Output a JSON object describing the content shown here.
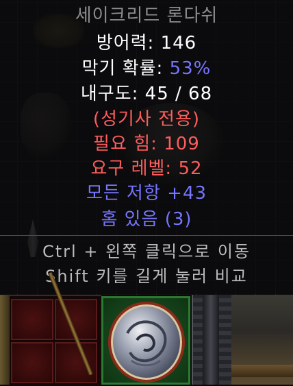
{
  "tooltip": {
    "item_name": "세이크리드 론다쉬",
    "defense": "방어력: 146",
    "block_label": "막기 확률: ",
    "block_value": "53%",
    "durability": "내구도: 45 / 68",
    "class_only": "(성기사 전용)",
    "req_str": "필요 힘: 109",
    "req_level": "요구 레벨: 52",
    "all_resist": "모든 저항 +43",
    "sockets": "홈 있음 (3)",
    "hint_move": "Ctrl + 왼쪽 클릭으로 이동",
    "hint_compare": "Shift 키를 길게 눌러 비교"
  },
  "colors": {
    "name": "#8c8c8c",
    "white": "#ffffff",
    "magic_blue": "#7676ff",
    "requirement_red": "#ff5c5c",
    "hint": "#bcbcbc"
  }
}
